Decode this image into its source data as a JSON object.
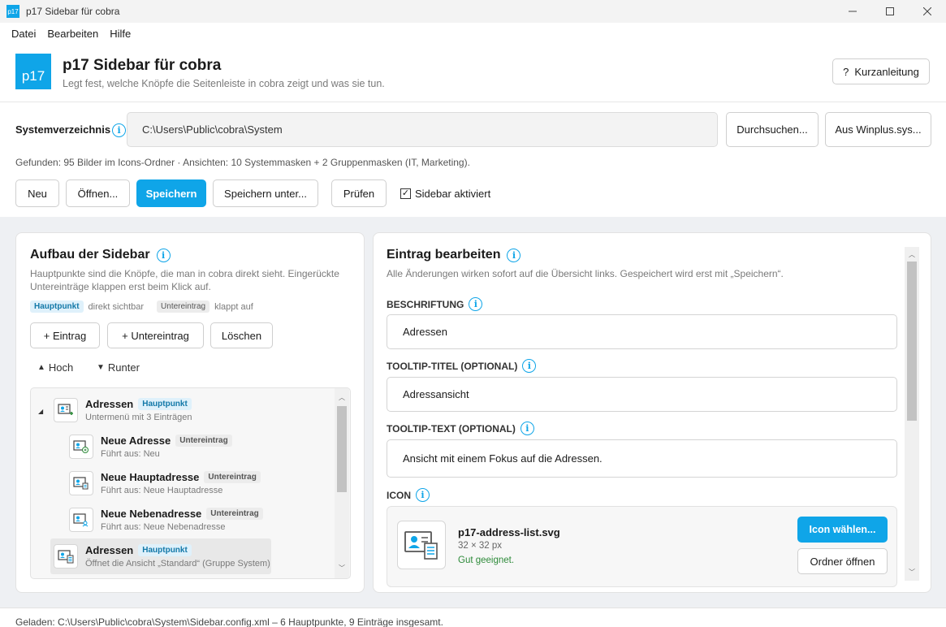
{
  "window": {
    "title": "p17 Sidebar für cobra",
    "icon_text": "p17",
    "controls": [
      "minimize-icon",
      "maximize-icon",
      "close-icon"
    ]
  },
  "menu": [
    "Datei",
    "Bearbeiten",
    "Hilfe"
  ],
  "header": {
    "logo": "p17",
    "title": "p17 Sidebar für cobra",
    "subtitle": "Legt fest, welche Knöpfe die Seitenleiste in cobra zeigt und was sie tun.",
    "help_button": "Kurzanleitung",
    "help_icon": "?"
  },
  "system": {
    "label": "Systemverzeichnis",
    "path": "C:\\Users\\Public\\cobra\\System",
    "browse_button": "Durchsuchen...",
    "winplus_button": "Aus Winplus.sys...",
    "found_text": "Gefunden: 95 Bilder im Icons-Ordner  ·  Ansichten: 10 Systemmasken + 2 Gruppenmasken (IT, Marketing)."
  },
  "toolbar": {
    "new": "Neu",
    "open": "Öffnen...",
    "save": "Speichern",
    "save_as": "Speichern unter...",
    "check": "Prüfen",
    "sidebar_enabled_label": "Sidebar aktiviert",
    "sidebar_enabled": true
  },
  "left_panel": {
    "title": "Aufbau der Sidebar",
    "description": "Hauptpunkte sind die Knöpfe, die man in cobra direkt sieht. Eingerückte Untereinträge klappen erst beim Klick auf.",
    "legend": {
      "main_badge": "Hauptpunkt",
      "main_text": "direkt sichtbar",
      "sub_badge": "Untereintrag",
      "sub_text": "klappt auf"
    },
    "add_entry": "+ Eintrag",
    "add_subentry": "+ Untereintrag",
    "delete": "Löschen",
    "up": "Hoch",
    "down": "Runter",
    "tree": [
      {
        "name": "Adressen",
        "badge": "Hauptpunkt",
        "sub": "Untermenü mit 3 Einträgen",
        "level": 0,
        "expanded": true
      },
      {
        "name": "Neue Adresse",
        "badge": "Untereintrag",
        "sub": "Führt aus: Neu",
        "level": 1
      },
      {
        "name": "Neue Hauptadresse",
        "badge": "Untereintrag",
        "sub": "Führt aus: Neue Hauptadresse",
        "level": 1
      },
      {
        "name": "Neue Nebenadresse",
        "badge": "Untereintrag",
        "sub": "Führt aus: Neue Nebenadresse",
        "level": 1
      },
      {
        "name": "Adressen",
        "badge": "Hauptpunkt",
        "sub": "Öffnet die Ansicht „Standard“ (Gruppe System)",
        "level": 0,
        "selected": true
      }
    ]
  },
  "right_panel": {
    "title": "Eintrag bearbeiten",
    "description": "Alle Änderungen wirken sofort auf die Übersicht links. Gespeichert wird erst mit „Speichern“.",
    "label_caption": "BESCHRIFTUNG",
    "label_value": "Adressen",
    "tooltip_title_caption": "TOOLTIP-TITEL (OPTIONAL)",
    "tooltip_title_value": "Adressansicht",
    "tooltip_text_caption": "TOOLTIP-TEXT (OPTIONAL)",
    "tooltip_text_value": "Ansicht mit einem Fokus auf die Adressen.",
    "icon_caption": "ICON",
    "icon_file": "p17-address-list.svg",
    "icon_size": "32 × 32 px",
    "icon_status": "Gut geeignet.",
    "choose_icon": "Icon wählen...",
    "open_folder": "Ordner öffnen"
  },
  "status": "Geladen: C:\\Users\\Public\\cobra\\System\\Sidebar.config.xml  –  6 Hauptpunkte, 9 Einträge insgesamt.",
  "colors": {
    "accent": "#0fa5e8",
    "ok": "#2e8b3a",
    "background": "#eef0f3"
  }
}
